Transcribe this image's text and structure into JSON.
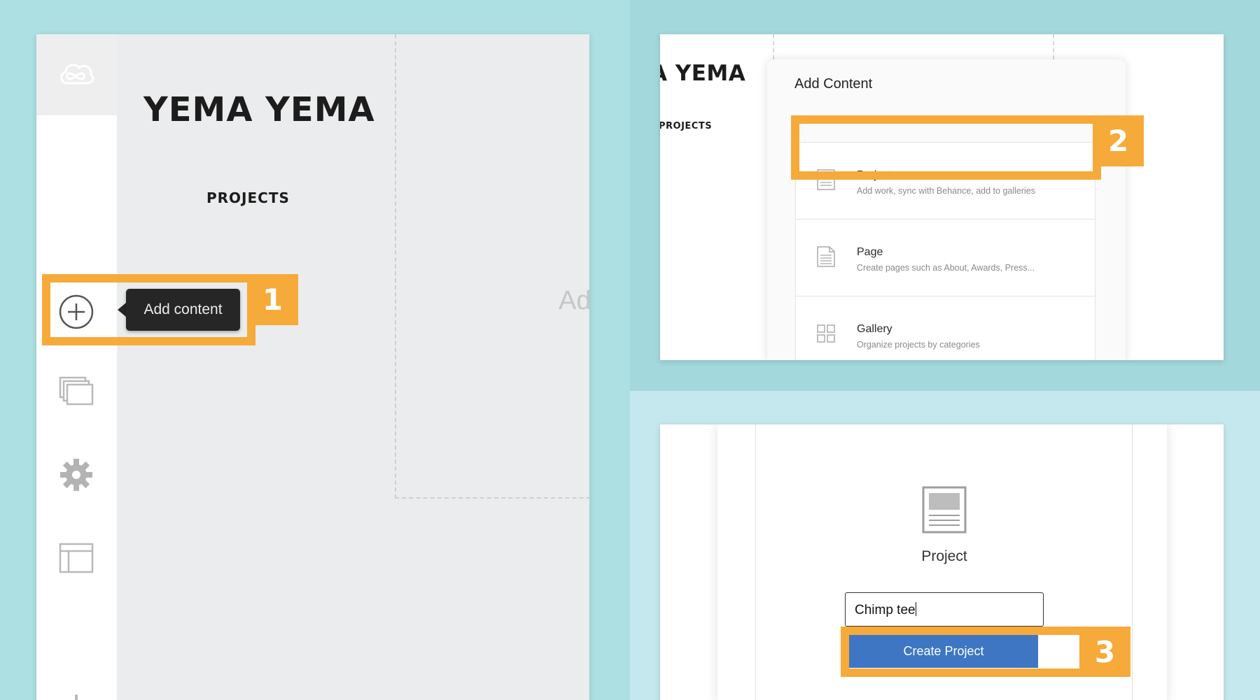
{
  "colors": {
    "highlight": "#f6aa3a",
    "primary_button": "#3e76c4",
    "background_left": "#ade0e3",
    "background_top_right": "#a3d8dc",
    "background_bottom_right": "#c5e8ef"
  },
  "step1": {
    "site_title": "YEMA YEMA",
    "nav_label": "PROJECTS",
    "tooltip": "Add content",
    "step_number": "1",
    "ghost_text": "Ad",
    "sidebar_icons": [
      "creative-cloud-icon",
      "add-content-icon",
      "pages-stack-icon",
      "gear-icon",
      "layout-icon"
    ]
  },
  "step2": {
    "site_title": "A YEMA",
    "nav_label": "PROJECTS",
    "modal_title": "Add Content",
    "step_number": "2",
    "options": [
      {
        "title": "Project",
        "description": "Add work, sync with Behance, add to galleries",
        "icon": "project-icon"
      },
      {
        "title": "Page",
        "description": "Create pages such as About, Awards, Press...",
        "icon": "page-icon"
      },
      {
        "title": "Gallery",
        "description": "Organize projects by categories",
        "icon": "gallery-icon"
      }
    ]
  },
  "step3": {
    "type_label": "Project",
    "project_name_value": "Chimp tee",
    "create_button": "Create Project",
    "step_number": "3"
  }
}
